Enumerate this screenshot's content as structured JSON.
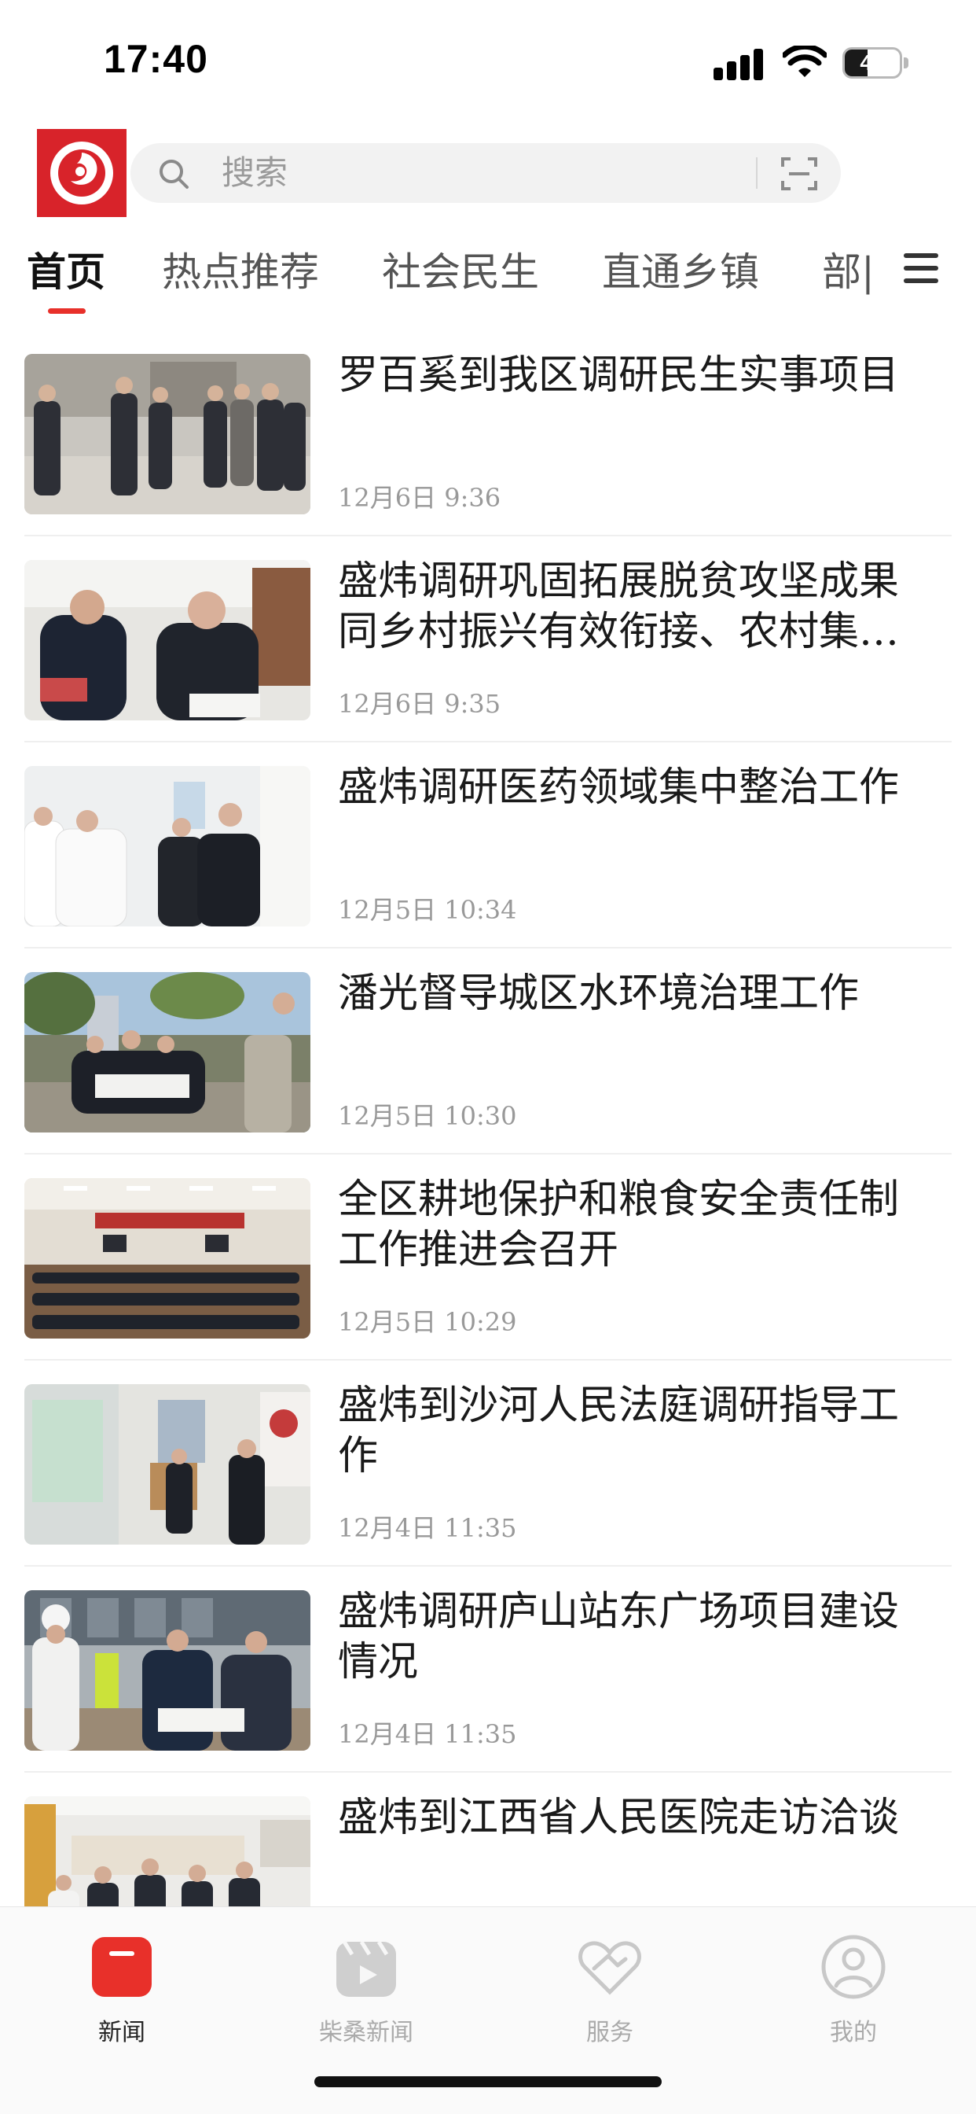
{
  "status_bar": {
    "time": "17:40",
    "battery": "41",
    "battery_level": 0.41
  },
  "header": {
    "search_placeholder": "搜索"
  },
  "tabs": [
    {
      "label": "首页",
      "active": true
    },
    {
      "label": "热点推荐",
      "active": false
    },
    {
      "label": "社会民生",
      "active": false
    },
    {
      "label": "直通乡镇",
      "active": false
    },
    {
      "label": "部|",
      "active": false
    }
  ],
  "news": [
    {
      "title": "罗百奚到我区调研民生实事项目",
      "date": "12月6日  9:36",
      "thumb": "officials-street-inspection"
    },
    {
      "title": "盛炜调研巩固拓展脱贫攻坚成果同乡村振兴有效衔接、农村集…",
      "date": "12月6日  9:35",
      "thumb": "officials-reading-documents"
    },
    {
      "title": "盛炜调研医药领域集中整治工作",
      "date": "12月5日  10:34",
      "thumb": "hospital-visit"
    },
    {
      "title": "潘光督导城区水环境治理工作",
      "date": "12月5日  10:30",
      "thumb": "riverside-inspection"
    },
    {
      "title": "全区耕地保护和粮食安全责任制工作推进会召开",
      "date": "12月5日  10:29",
      "thumb": "conference-hall"
    },
    {
      "title": "盛炜到沙河人民法庭调研指导工作",
      "date": "12月4日  11:35",
      "thumb": "court-office-visit"
    },
    {
      "title": "盛炜调研庐山站东广场项目建设情况",
      "date": "12月4日  11:35",
      "thumb": "construction-site"
    },
    {
      "title": "盛炜到江西省人民医院走访洽谈",
      "date": "",
      "thumb": "hospital-lobby"
    }
  ],
  "bottom_nav": [
    {
      "label": "新闻",
      "icon": "news-icon",
      "active": true
    },
    {
      "label": "柴桑新闻",
      "icon": "video-icon",
      "active": false
    },
    {
      "label": "服务",
      "icon": "heart-hand-icon",
      "active": false
    },
    {
      "label": "我的",
      "icon": "profile-icon",
      "active": false
    }
  ],
  "colors": {
    "brand_red": "#d8232a",
    "accent_red": "#e8302a"
  }
}
